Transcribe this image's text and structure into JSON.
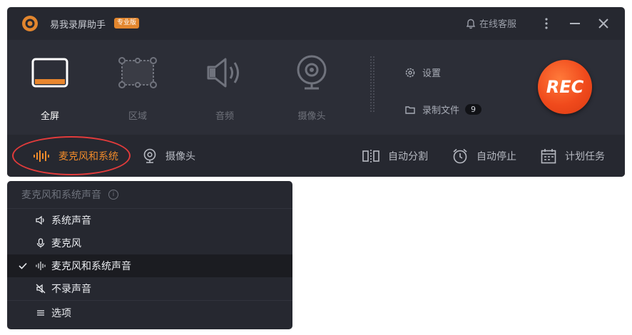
{
  "app": {
    "title": "易我录屏助手",
    "badge": "专业版"
  },
  "titlebar": {
    "support": "在线客服"
  },
  "modes": [
    {
      "label": "全屏",
      "active": true
    },
    {
      "label": "区域",
      "active": false
    },
    {
      "label": "音频",
      "active": false
    },
    {
      "label": "摄像头",
      "active": false
    }
  ],
  "side": {
    "settings": "设置",
    "recorded_files": "录制文件",
    "recorded_count": "9"
  },
  "rec_button": "REC",
  "bottom": {
    "audio_source": "麦克风和系统",
    "camera": "摄像头",
    "auto_split": "自动分割",
    "auto_stop": "自动停止",
    "schedule": "计划任务"
  },
  "dropdown": {
    "header": "麦克风和系统声音",
    "items": [
      {
        "label": "系统声音",
        "icon": "speaker-icon"
      },
      {
        "label": "麦克风",
        "icon": "mic-icon"
      },
      {
        "label": "麦克风和系统声音",
        "icon": "waveform-icon",
        "selected": true
      },
      {
        "label": "不录声音",
        "icon": "mute-icon"
      }
    ],
    "options": "选项"
  },
  "colors": {
    "accent": "#ef8a2a",
    "rec": "#f04a1c",
    "highlight": "#e23b3b"
  }
}
